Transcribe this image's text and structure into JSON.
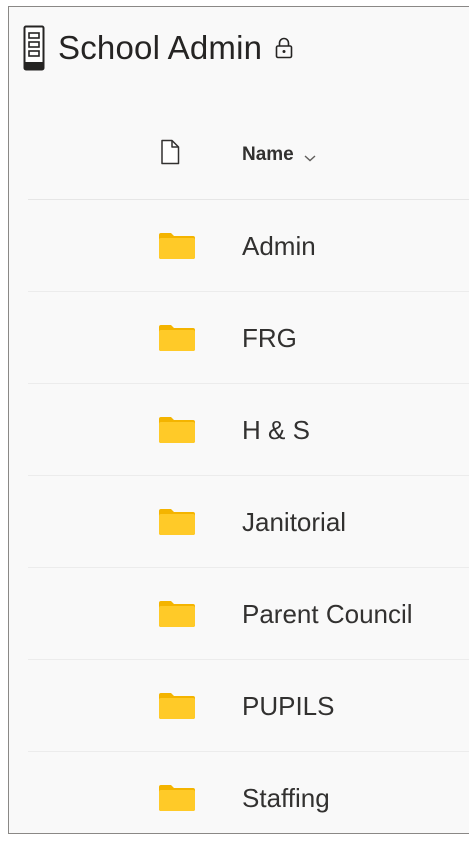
{
  "library": {
    "title": "School Admin",
    "icon": "document-library-icon",
    "lock_icon": "lock-icon"
  },
  "list_header": {
    "file_type_icon": "document-icon",
    "name_column_label": "Name",
    "sort_icon": "chevron-down-icon"
  },
  "folders": [
    {
      "name": "Admin",
      "icon": "folder-icon"
    },
    {
      "name": "FRG",
      "icon": "folder-icon"
    },
    {
      "name": "H & S",
      "icon": "folder-icon"
    },
    {
      "name": "Janitorial",
      "icon": "folder-icon"
    },
    {
      "name": "Parent Council",
      "icon": "folder-icon"
    },
    {
      "name": "PUPILS",
      "icon": "folder-icon"
    },
    {
      "name": "Staffing",
      "icon": "folder-icon"
    }
  ],
  "colors": {
    "folder_yellow": "#FFCA28",
    "folder_tab": "#F4B400",
    "text_primary": "#323130",
    "border": "#8a8886"
  }
}
